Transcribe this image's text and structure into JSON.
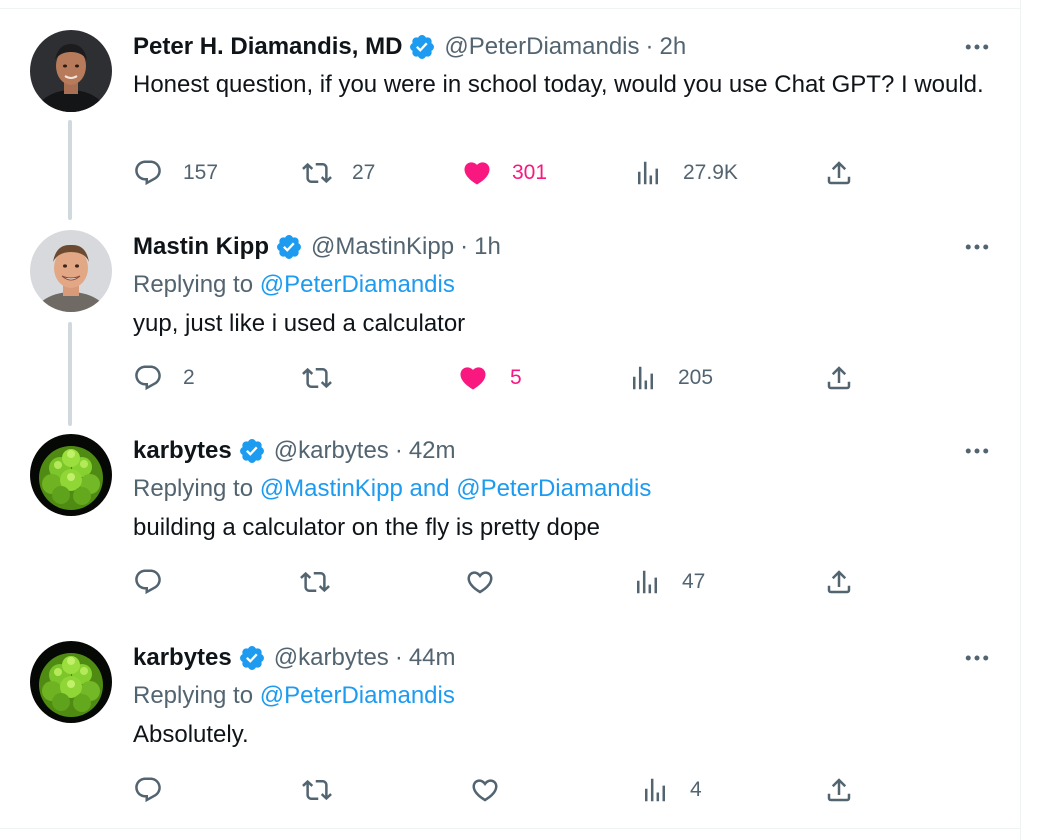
{
  "colors": {
    "accent": "#1d9bf0",
    "like": "#f91880",
    "muted": "#536471",
    "text": "#0f1419"
  },
  "tweets": [
    {
      "name": "Peter H. Diamandis, MD",
      "handle": "@PeterDiamandis",
      "sep": "·",
      "time": "2h",
      "text": "Honest question, if you were in school today, would you use Chat GPT? I would.",
      "stats": {
        "replies": "157",
        "retweets": "27",
        "likes": "301",
        "views": "27.9K"
      },
      "liked": true,
      "avatar": "avatar-peter"
    },
    {
      "name": "Mastin Kipp",
      "handle": "@MastinKipp",
      "sep": "·",
      "time": "1h",
      "replying_label": "Replying to ",
      "replying_to": "@PeterDiamandis",
      "text": "yup, just like i used a calculator",
      "stats": {
        "replies": "2",
        "retweets": "",
        "likes": "5",
        "views": "205"
      },
      "liked": true,
      "avatar": "avatar-mastin"
    },
    {
      "name": "karbytes",
      "handle": "@karbytes",
      "sep": "·",
      "time": "42m",
      "replying_label": "Replying to ",
      "replying_to": "@MastinKipp and @PeterDiamandis",
      "text": "building a calculator on the fly is pretty dope",
      "stats": {
        "replies": "",
        "retweets": "",
        "likes": "",
        "views": "47"
      },
      "liked": false,
      "avatar": "avatar-karbytes"
    },
    {
      "name": "karbytes",
      "handle": "@karbytes",
      "sep": "·",
      "time": "44m",
      "replying_label": "Replying to ",
      "replying_to": "@PeterDiamandis",
      "text": "Absolutely.",
      "stats": {
        "replies": "",
        "retweets": "",
        "likes": "",
        "views": "4"
      },
      "liked": false,
      "avatar": "avatar-karbytes"
    }
  ]
}
